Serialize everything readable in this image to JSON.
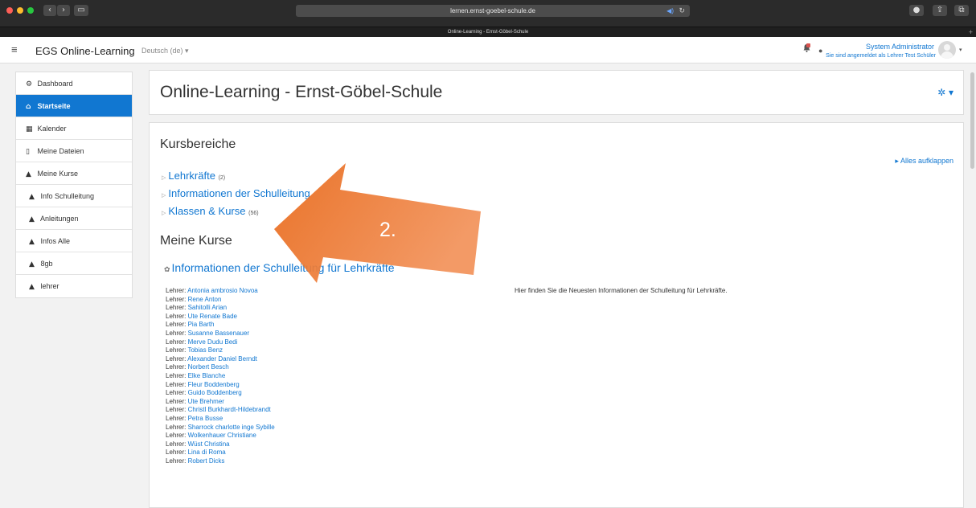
{
  "browser": {
    "url": "lernen.ernst-goebel-schule.de",
    "tab_title": "Online-Learning - Ernst-Göbel-Schule",
    "new_tab": "+"
  },
  "navbar": {
    "brand": "EGS Online-Learning",
    "language": "Deutsch (de)",
    "user_name": "System Administrator",
    "user_sub": "Sie sind angemeldet als Lehrer Test Schüler"
  },
  "sidebar": {
    "items": [
      {
        "label": "Dashboard",
        "icon": "dashboard-icon",
        "glyph": "⚙"
      },
      {
        "label": "Startseite",
        "icon": "home-icon",
        "glyph": "⌂",
        "active": true
      },
      {
        "label": "Kalender",
        "icon": "calendar-icon",
        "glyph": "▦"
      },
      {
        "label": "Meine Dateien",
        "icon": "file-icon",
        "glyph": "▯"
      },
      {
        "label": "Meine Kurse",
        "icon": "graduation-cap-icon",
        "glyph": "▲"
      },
      {
        "label": "Info Schulleitung",
        "icon": "graduation-cap-icon",
        "glyph": "▲"
      },
      {
        "label": "Anleitungen",
        "icon": "graduation-cap-icon",
        "glyph": "▲"
      },
      {
        "label": "Infos Alle",
        "icon": "graduation-cap-icon",
        "glyph": "▲"
      },
      {
        "label": "8gb",
        "icon": "graduation-cap-icon",
        "glyph": "▲"
      },
      {
        "label": "lehrer",
        "icon": "graduation-cap-icon",
        "glyph": "▲"
      }
    ]
  },
  "header": {
    "title": "Online-Learning - Ernst-Göbel-Schule"
  },
  "main": {
    "kursbereiche_heading": "Kursbereiche",
    "expand_all": "Alles aufklappen",
    "categories": [
      {
        "name": "Lehrkräfte",
        "count": "(2)"
      },
      {
        "name": "Informationen der Schulleitung",
        "count": ""
      },
      {
        "name": "Klassen & Kurse",
        "count": "(56)"
      }
    ],
    "meine_kurse_heading": "Meine Kurse",
    "course_title": "Informationen der Schulleitung für Lehrkräfte",
    "teacher_label": "Lehrer:",
    "teachers": [
      "Antonia ambrosio Novoa",
      "Rene Anton",
      "Sahitolli Arian",
      "Ute Renate Bade",
      "Pia Barth",
      "Susanne Bassenauer",
      "Merve Dudu Bedi",
      "Tobias Benz",
      "Alexander Daniel Berndt",
      "Norbert Besch",
      "Elke Blanche",
      "Fleur Boddenberg",
      "Guido Boddenberg",
      "Ute Brehmer",
      "Christl Burkhardt-Hildebrandt",
      "Petra Busse",
      "Sharrock charlotte inge Sybille",
      "Wolkenhauer Christiane",
      "Wüst Christina",
      "Lina di Roma",
      "Robert Dicks"
    ],
    "course_summary": "Hier finden Sie die Neuesten Informationen der Schulleitung für Lehrkräfte."
  },
  "annotation": {
    "label": "2.",
    "color": "#e9711f"
  }
}
